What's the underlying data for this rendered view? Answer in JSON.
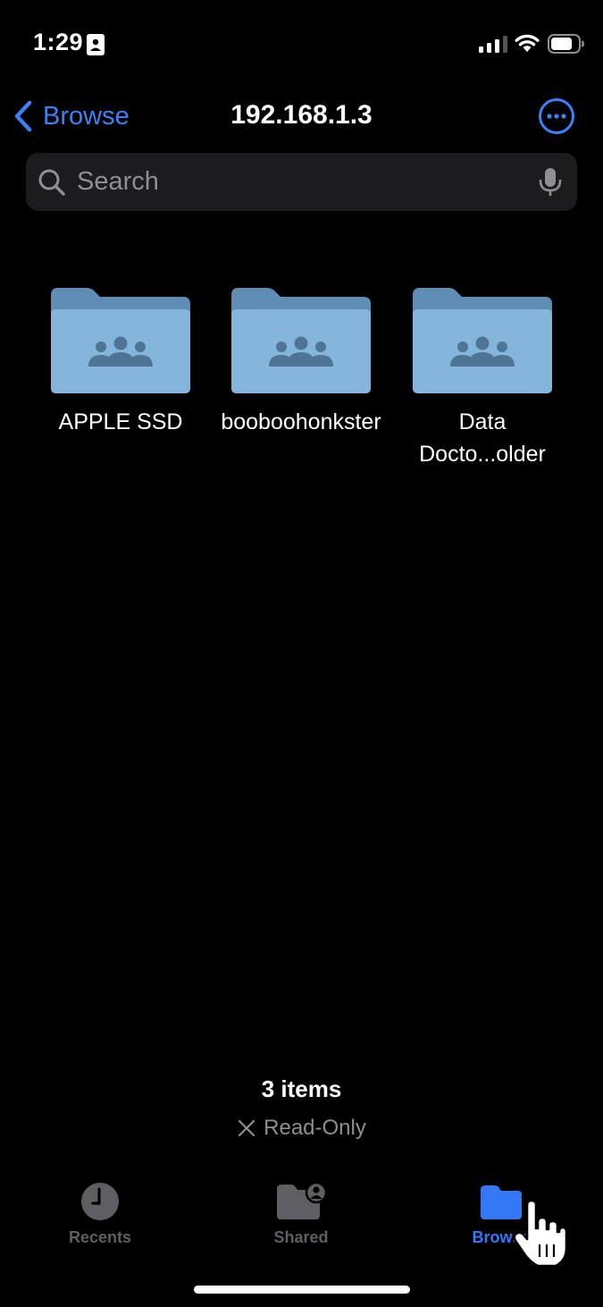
{
  "status_bar": {
    "time": "1:29"
  },
  "nav": {
    "back_label": "Browse",
    "title": "192.168.1.3"
  },
  "search": {
    "placeholder": "Search"
  },
  "folders": [
    {
      "name": "APPLE SSD"
    },
    {
      "name": "booboohonkster"
    },
    {
      "name": "Data Docto...older"
    }
  ],
  "footer": {
    "items_count": "3 items",
    "read_only": "Read-Only"
  },
  "tabs": [
    {
      "label": "Recents",
      "icon": "clock-icon"
    },
    {
      "label": "Shared",
      "icon": "shared-folder-icon"
    },
    {
      "label": "Browse",
      "icon": "folder-icon"
    }
  ],
  "colors": {
    "accent": "#3b82f6",
    "folder": "#7fb0d6",
    "search_bg": "#1c1c1e"
  }
}
